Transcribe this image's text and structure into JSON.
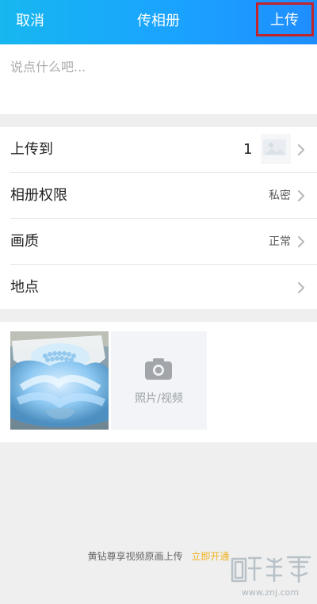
{
  "colors": {
    "header_gradient_start": "#17b7f0",
    "header_gradient_end": "#1f8dff",
    "highlight_border": "#c1252c",
    "link_gold": "#f0b31f",
    "background": "#efefef"
  },
  "header": {
    "cancel_label": "取消",
    "title": "传相册",
    "upload_label": "上传"
  },
  "composer": {
    "placeholder": "说点什么吧..."
  },
  "settings": {
    "upload_to": {
      "label": "上传到",
      "count": "1"
    },
    "permission": {
      "label": "相册权限",
      "value": "私密"
    },
    "quality": {
      "label": "画质",
      "value": "正常"
    },
    "location": {
      "label": "地点"
    }
  },
  "media": {
    "add_label": "照片/视频"
  },
  "promo": {
    "text": "黄钻尊享视频原画上传",
    "link": "立即开通"
  },
  "icons": {
    "chevron": "chevron-right-icon",
    "camera": "camera-icon"
  },
  "watermark": {
    "logo": "智能家",
    "url": "www.znj.com"
  }
}
